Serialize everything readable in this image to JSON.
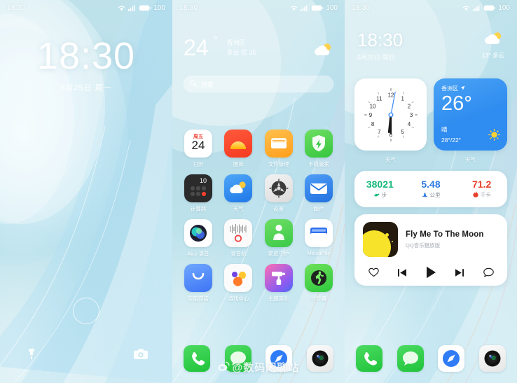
{
  "status": {
    "time": "18:30",
    "battery": "100",
    "wifi_icon": "wifi-icon",
    "signal_icon": "signal-icon",
    "battery_icon": "battery-icon"
  },
  "lock": {
    "time": "18:30",
    "date": "6月25日 周一",
    "flashlight_icon": "flashlight-icon",
    "camera_icon": "camera-icon",
    "fingerprint_icon": "fingerprint-icon"
  },
  "home": {
    "weather": {
      "temp": "24",
      "degree": "°",
      "city": "香洲区",
      "condition": "多云 优 35",
      "icon": "partly-cloudy-icon"
    },
    "search": {
      "placeholder": "搜索",
      "icon": "search-icon"
    },
    "apps": [
      [
        {
          "label": "日历",
          "icon": "calendar-icon",
          "weekday": "周五",
          "day": "24"
        },
        {
          "label": "图库",
          "icon": "gallery-icon"
        },
        {
          "label": "文件管理",
          "icon": "file-manager-icon"
        },
        {
          "label": "手机管家",
          "icon": "phone-manager-icon"
        }
      ],
      [
        {
          "label": "计算器",
          "icon": "calculator-icon",
          "display": "10"
        },
        {
          "label": "天气",
          "icon": "weather-icon"
        },
        {
          "label": "设置",
          "icon": "settings-icon"
        },
        {
          "label": "邮件",
          "icon": "mail-icon"
        }
      ],
      [
        {
          "label": "Aicy 语音",
          "icon": "aicy-voice-icon"
        },
        {
          "label": "录音机",
          "icon": "recorder-icon"
        },
        {
          "label": "家庭守护",
          "icon": "family-guard-icon"
        },
        {
          "label": "MeizuPay",
          "icon": "meizupay-icon"
        }
      ],
      [
        {
          "label": "应用商店",
          "icon": "app-store-icon"
        },
        {
          "label": "游戏中心",
          "icon": "game-center-icon"
        },
        {
          "label": "主题美化",
          "icon": "theme-icon"
        },
        {
          "label": "计步器",
          "icon": "pedometer-icon"
        }
      ]
    ],
    "dock": [
      {
        "label": "电话",
        "icon": "phone-icon"
      },
      {
        "label": "短信",
        "icon": "messages-icon"
      },
      {
        "label": "浏览器",
        "icon": "browser-compass-icon"
      },
      {
        "label": "相机",
        "icon": "camera-app-icon"
      }
    ],
    "watermark": "@数码闲聊站",
    "watermark_icon": "weibo-icon"
  },
  "widgets_screen": {
    "header": {
      "time": "18:30",
      "date": "6月25日 周四",
      "weather_temp": "13°",
      "weather_cond": "多云",
      "weather_icon": "partly-cloudy-icon"
    },
    "clock_widget": {
      "label": "天气",
      "hours": "12",
      "numerals": [
        "12",
        "1",
        "2",
        "3",
        "4",
        "5",
        "6",
        "7",
        "8",
        "9",
        "10",
        "11"
      ]
    },
    "weather_widget": {
      "label": "天气",
      "city": "香洲区",
      "location_icon": "location-arrow-icon",
      "temp": "26°",
      "condition": "晴",
      "high_low": "28°/22°",
      "icon": "sun-icon",
      "accent": "#2f8cf0"
    },
    "fitness": [
      {
        "value": "38021",
        "unit": "步",
        "icon": "shoe-icon",
        "color": "#16b97a"
      },
      {
        "value": "5.48",
        "unit": "公里",
        "icon": "distance-icon",
        "color": "#2f7be0"
      },
      {
        "value": "71.2",
        "unit": "千卡",
        "icon": "flame-icon",
        "color": "#e8402a"
      }
    ],
    "music": {
      "title": "Fly Me To The Moon",
      "subtitle": "QQ音乐魅族版",
      "album_icon": "moon-album-art",
      "controls": [
        {
          "name": "favorite-button",
          "icon": "heart-icon"
        },
        {
          "name": "previous-button",
          "icon": "skip-previous-icon"
        },
        {
          "name": "play-button",
          "icon": "play-icon"
        },
        {
          "name": "next-button",
          "icon": "skip-next-icon"
        },
        {
          "name": "comment-button",
          "icon": "comment-icon"
        }
      ]
    }
  }
}
